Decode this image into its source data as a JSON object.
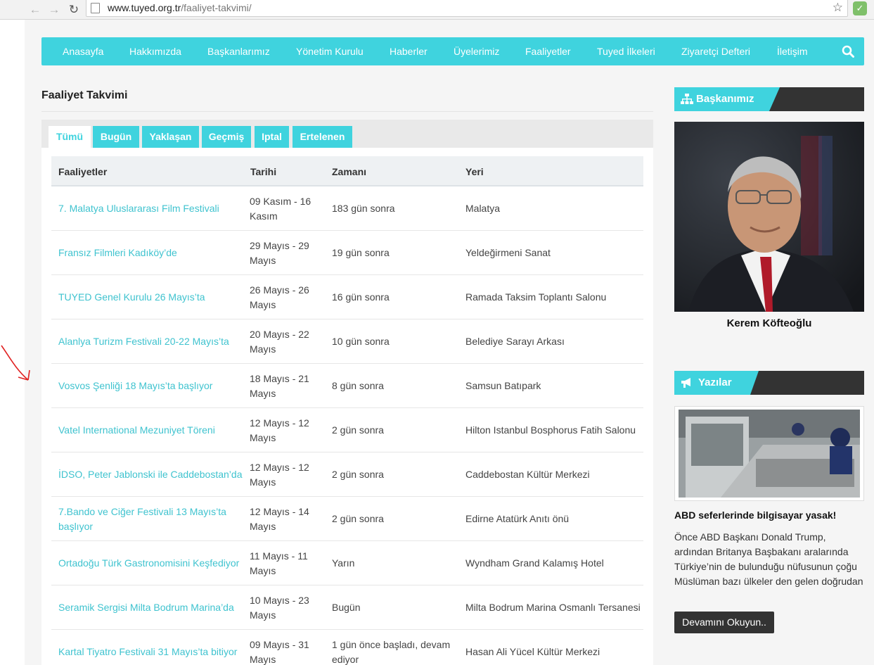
{
  "browser": {
    "back_icon": "arrow-left-icon",
    "forward_icon": "arrow-right-icon",
    "reload_icon": "reload-icon",
    "url_domain": "www.tuyed.org.tr",
    "url_path": "/faaliyet-takvimi/"
  },
  "nav": {
    "items": [
      "Anasayfa",
      "Hakkımızda",
      "Başkanlarımız",
      "Yönetim Kurulu",
      "Haberler",
      "Üyelerimiz",
      "Faaliyetler",
      "Tuyed İlkeleri",
      "Ziyaretçi Defteri",
      "İletişim"
    ],
    "accent": "#3fd3de"
  },
  "page": {
    "title": "Faaliyet Takvimi"
  },
  "tabs": [
    "Tümü",
    "Bugün",
    "Yaklaşan",
    "Geçmiş",
    "Iptal",
    "Ertelenen"
  ],
  "table": {
    "headers": [
      "Faaliyetler",
      "Tarihi",
      "Zamanı",
      "Yeri"
    ],
    "rows": [
      {
        "name": "7. Malatya Uluslararası Film Festivali",
        "date": "09 Kasım - 16 Kasım",
        "time": "183 gün sonra",
        "place": "Malatya"
      },
      {
        "name": "Fransız Filmleri Kadıköy’de",
        "date": "29 Mayıs - 29 Mayıs",
        "time": "19 gün sonra",
        "place": "Yeldeğirmeni Sanat"
      },
      {
        "name": "TUYED Genel Kurulu 26 Mayıs’ta",
        "date": "26 Mayıs - 26 Mayıs",
        "time": "16 gün sonra",
        "place": "Ramada Taksim Toplantı Salonu"
      },
      {
        "name": "Alanlya Turizm Festivali 20-22 Mayıs’ta",
        "date": "20 Mayıs - 22 Mayıs",
        "time": "10 gün sonra",
        "place": "Belediye Sarayı Arkası"
      },
      {
        "name": "Vosvos Şenliği 18 Mayıs’ta başlıyor",
        "date": "18 Mayıs - 21 Mayıs",
        "time": "8 gün sonra",
        "place": "Samsun Batıpark"
      },
      {
        "name": "Vatel International Mezuniyet Töreni",
        "date": "12 Mayıs - 12 Mayıs",
        "time": "2 gün sonra",
        "place": "Hilton Istanbul Bosphorus Fatih Salonu"
      },
      {
        "name": "İDSO, Peter Jablonski ile Caddebostan’da",
        "date": "12 Mayıs - 12 Mayıs",
        "time": "2 gün sonra",
        "place": "Caddebostan Kültür Merkezi"
      },
      {
        "name": "7.Bando ve Ciğer Festivali 13 Mayıs’ta başlıyor",
        "date": "12 Mayıs - 14 Mayıs",
        "time": "2 gün sonra",
        "place": "Edirne Atatürk Anıtı önü"
      },
      {
        "name": "Ortadoğu Türk Gastronomisini Keşfediyor",
        "date": "11 Mayıs - 11 Mayıs",
        "time": "Yarın",
        "place": "Wyndham Grand Kalamış Hotel"
      },
      {
        "name": "Seramik Sergisi Milta Bodrum Marina’da",
        "date": "10 Mayıs - 23 Mayıs",
        "time": "Bugün",
        "place": "Milta Bodrum Marina Osmanlı Tersanesi"
      },
      {
        "name": "Kartal Tiyatro Festivali 31 Mayıs’ta bitiyor",
        "date": "09 Mayıs - 31 Mayıs",
        "time": "1 gün önce başladı, devam ediyor",
        "place": "Hasan Ali Yücel Kültür Merkezi"
      }
    ]
  },
  "sidebar": {
    "president": {
      "heading": "Başkanımız",
      "icon": "org-chart-icon",
      "name": "Kerem Köfteoğlu"
    },
    "posts": {
      "heading": "Yazılar",
      "icon": "megaphone-icon",
      "title": "ABD seferlerinde bilgisayar yasak!",
      "excerpt": "Önce ABD Başkanı Donald Trump, ardından Britanya Başbakanı aralarında Türkiye’nin de bulunduğu nüfusunun çoğu Müslüman bazı ülkeler den gelen doğrudan",
      "read_more": "Devamını Okuyun.."
    }
  }
}
